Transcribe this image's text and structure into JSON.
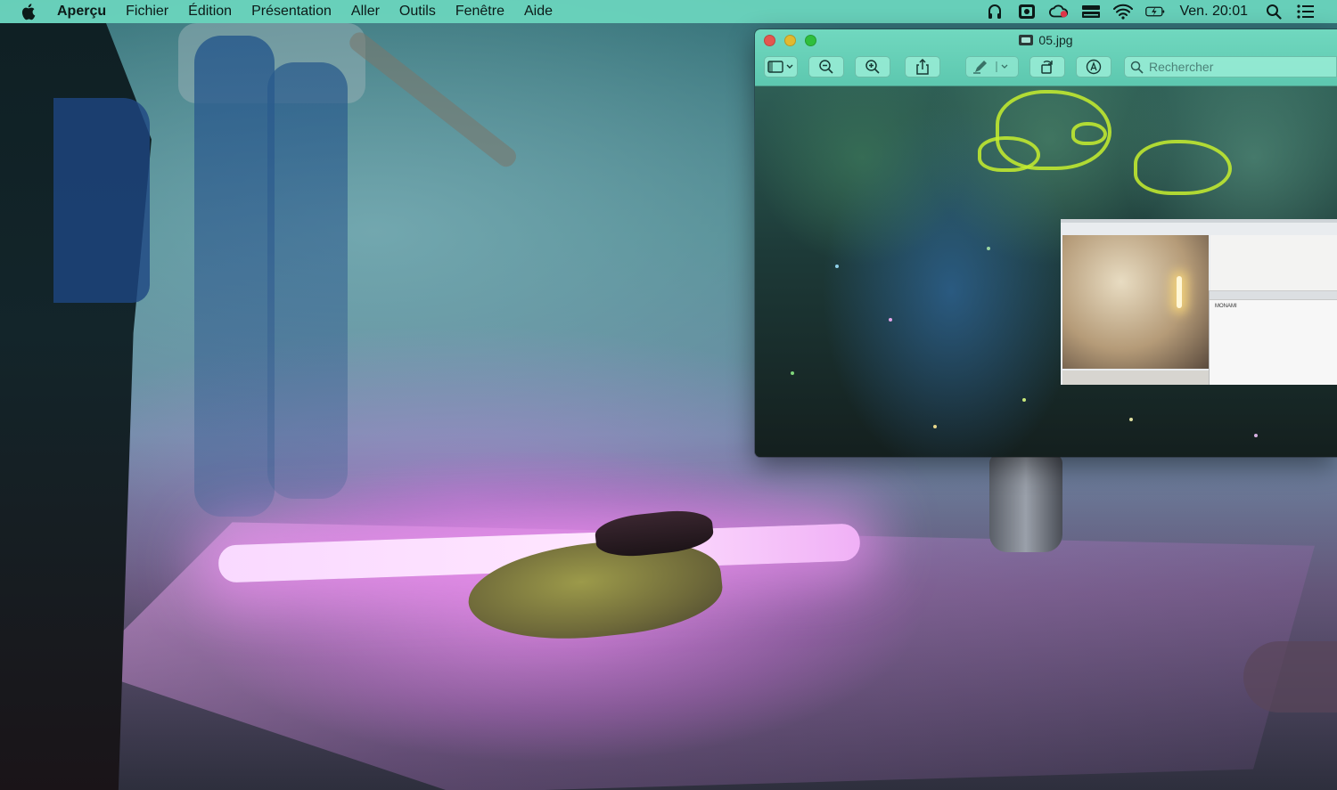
{
  "menubar": {
    "app_name": "Aperçu",
    "items": [
      "Fichier",
      "Édition",
      "Présentation",
      "Aller",
      "Outils",
      "Fenêtre",
      "Aide"
    ],
    "clock": "Ven. 20:01",
    "tray_icons": [
      "airpods-icon",
      "app-switcher-icon",
      "creative-cloud-icon",
      "drive-icon",
      "wifi-icon",
      "battery-icon"
    ]
  },
  "window": {
    "title": "05.jpg",
    "search_placeholder": "Rechercher",
    "embedded_doc_text": "MONAMI"
  },
  "colors": {
    "menubar_tint": "#6cd6be",
    "titlebar_tint": "#74dec4",
    "close": "#e4574f",
    "minimize": "#e2b92f",
    "maximize": "#2fbf3d",
    "highlight_yellow": "#c7ee2e",
    "neon_pink": "#f0b0f6"
  }
}
